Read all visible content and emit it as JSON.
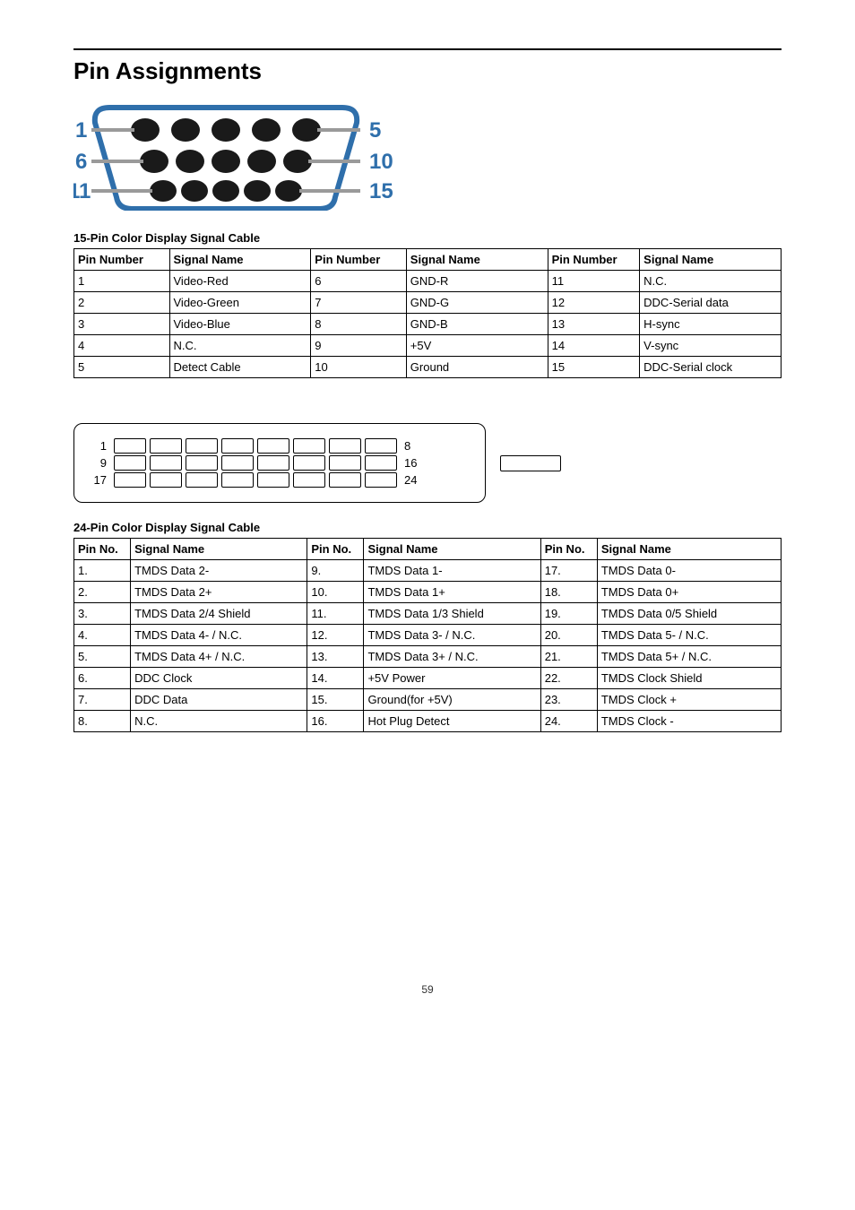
{
  "title": "Pin Assignments",
  "page_number": "59",
  "table15": {
    "caption": "15-Pin Color Display Signal Cable",
    "headers": [
      "Pin Number",
      "Signal Name",
      "Pin Number",
      "Signal Name",
      "Pin Number",
      "Signal Name"
    ],
    "rows": [
      [
        "1",
        "Video-Red",
        "6",
        "GND-R",
        "11",
        "N.C."
      ],
      [
        "2",
        "Video-Green",
        "7",
        "GND-G",
        "12",
        "DDC-Serial data"
      ],
      [
        "3",
        "Video-Blue",
        "8",
        "GND-B",
        "13",
        "H-sync"
      ],
      [
        "4",
        "N.C.",
        "9",
        "+5V",
        "14",
        "V-sync"
      ],
      [
        "5",
        "Detect Cable",
        "10",
        "Ground",
        "15",
        "DDC-Serial clock"
      ]
    ]
  },
  "diag2": {
    "row1_left": "1",
    "row1_right": "8",
    "row2_left": "9",
    "row2_right": "16",
    "row3_left": "17",
    "row3_right": "24"
  },
  "table24": {
    "caption": "24-Pin Color Display Signal Cable",
    "headers": [
      "Pin No.",
      "Signal Name",
      "Pin No.",
      "Signal Name",
      "Pin No.",
      "Signal Name"
    ],
    "rows": [
      [
        "1.",
        "TMDS Data 2-",
        "9.",
        "TMDS Data 1-",
        "17.",
        "TMDS Data 0-"
      ],
      [
        "2.",
        "TMDS Data 2+",
        "10.",
        "TMDS Data 1+",
        "18.",
        "TMDS Data 0+"
      ],
      [
        "3.",
        "TMDS Data 2/4 Shield",
        "11.",
        "TMDS Data 1/3 Shield",
        "19.",
        "TMDS Data 0/5 Shield"
      ],
      [
        "4.",
        "TMDS Data 4- / N.C.",
        "12.",
        "TMDS Data 3- / N.C.",
        "20.",
        "TMDS Data 5- / N.C."
      ],
      [
        "5.",
        "TMDS Data 4+ / N.C.",
        "13.",
        "TMDS Data 3+ / N.C.",
        "21.",
        "TMDS Data 5+ / N.C."
      ],
      [
        "6.",
        "DDC Clock",
        "14.",
        "+5V Power",
        "22.",
        "TMDS Clock Shield"
      ],
      [
        "7.",
        "DDC Data",
        "15.",
        "Ground(for +5V)",
        "23.",
        "TMDS Clock +"
      ],
      [
        "8.",
        "N.C.",
        "16.",
        "Hot Plug Detect",
        "24.",
        "TMDS Clock -"
      ]
    ]
  }
}
